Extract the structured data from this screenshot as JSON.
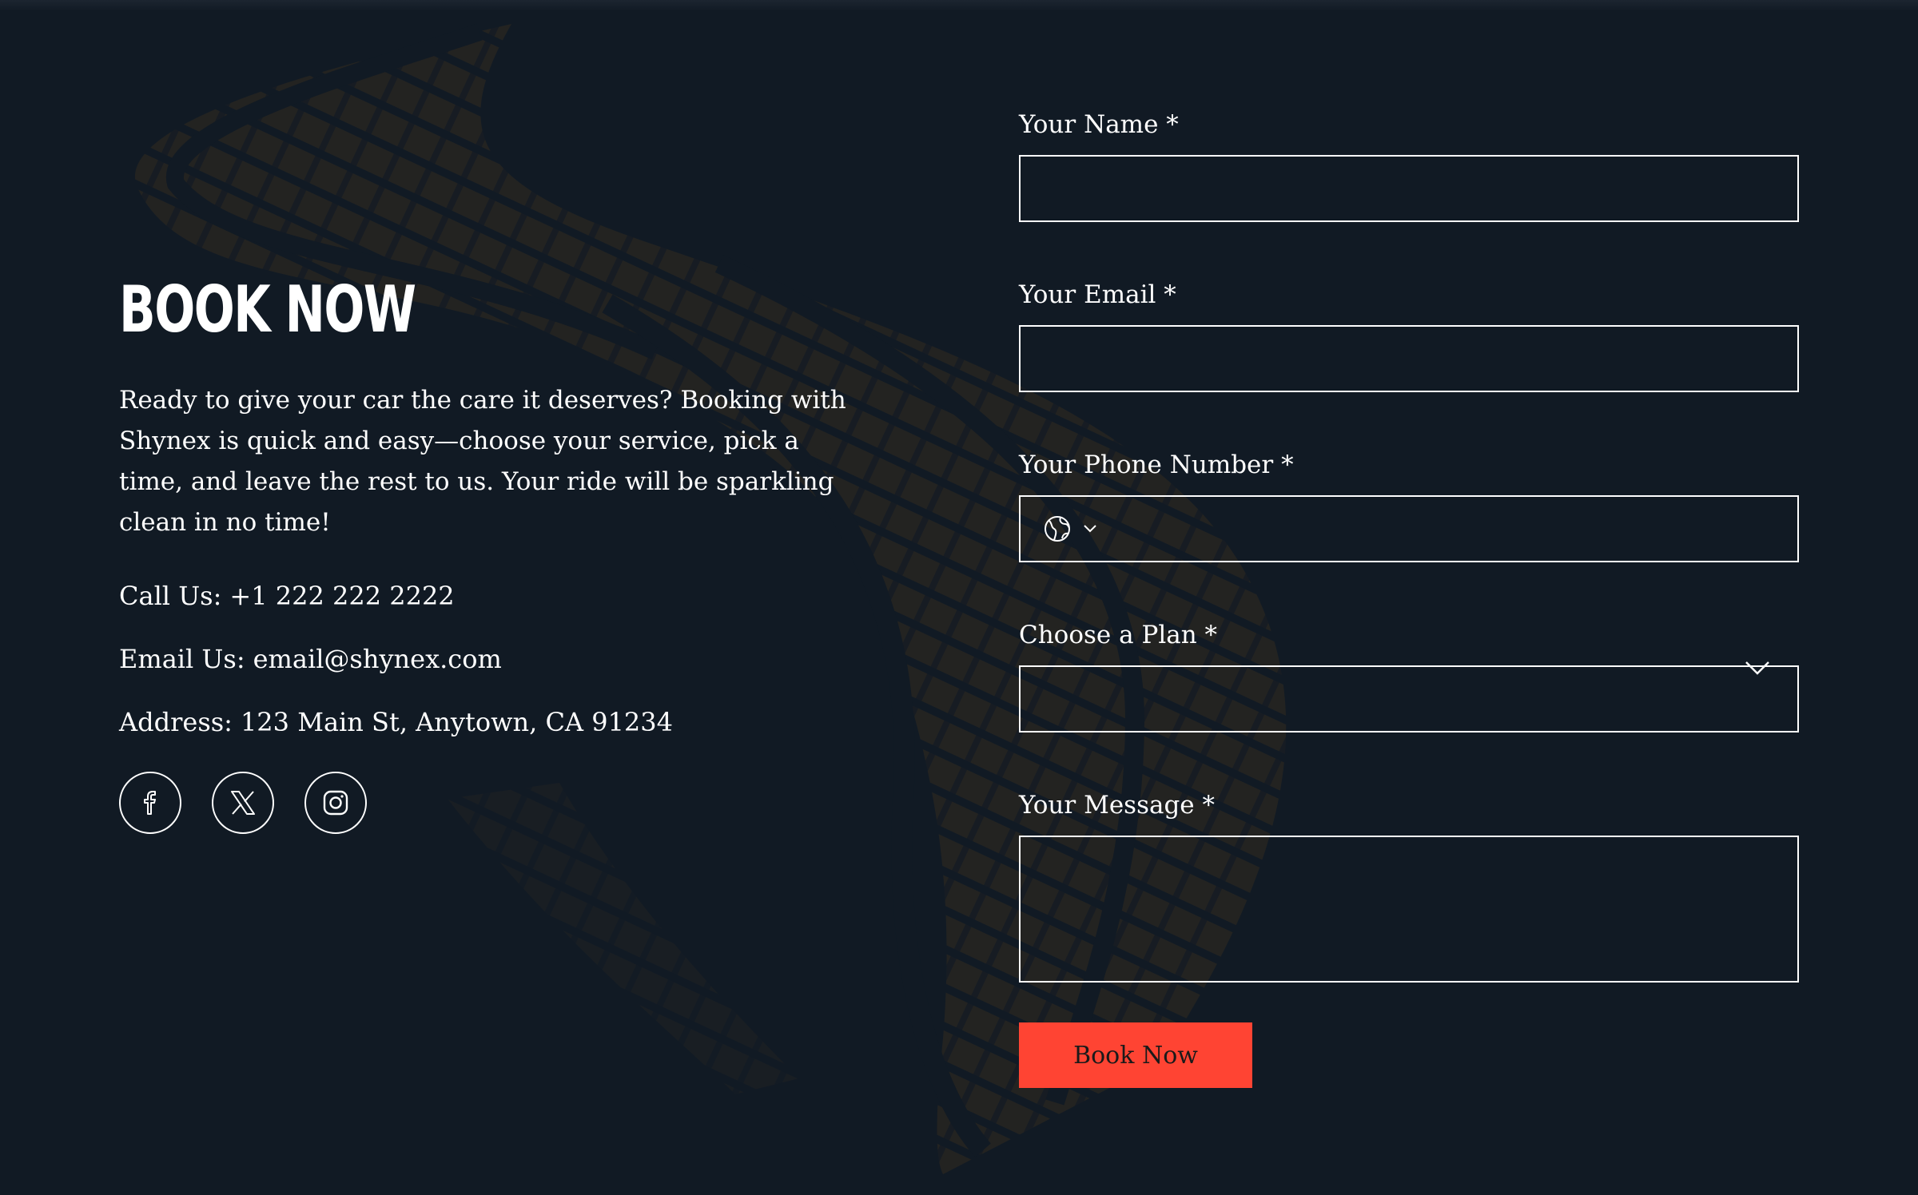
{
  "left": {
    "title": "BOOK NOW",
    "intro": "Ready to give your car the care it deserves? Booking with Shynex is quick and easy—choose your service, pick a time, and leave the rest to us. Your ride will be sparkling clean in no time!",
    "contact": {
      "phone_label": "Call Us:",
      "phone_value": "+1 222 222 2222",
      "email_label": "Email Us:",
      "email_value": "email@shynex.com",
      "address_label": "Address:",
      "address_value": "123 Main St, Anytown, CA 91234"
    },
    "socials": [
      {
        "icon": "facebook-icon"
      },
      {
        "icon": "x-icon"
      },
      {
        "icon": "instagram-icon"
      }
    ]
  },
  "form": {
    "name_label": "Your Name *",
    "email_label": "Your Email *",
    "phone_label": "Your Phone Number *",
    "plan_label": "Choose a Plan *",
    "message_label": "Your Message *",
    "name_value": "",
    "email_value": "",
    "phone_value": "",
    "plan_selected": "",
    "message_value": "",
    "submit_label": "Book Now"
  },
  "colors": {
    "background": "#111a24",
    "accent": "#ff4433",
    "track": "#2a2620"
  }
}
